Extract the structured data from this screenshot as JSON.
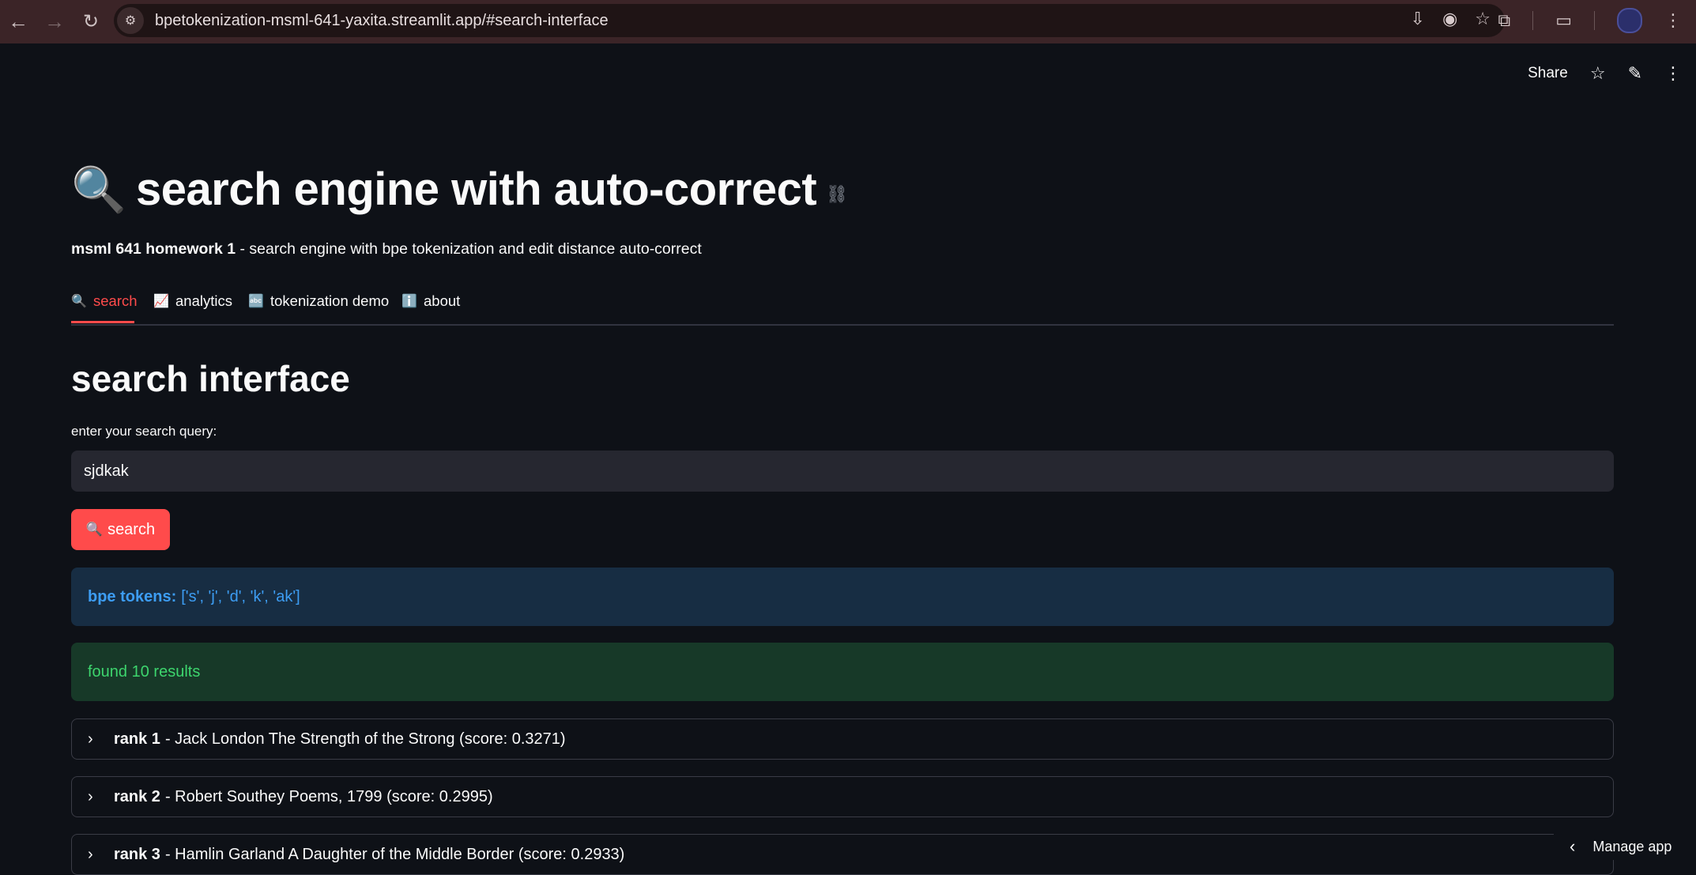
{
  "browser": {
    "url": "bpetokenization-msml-641-yaxita.streamlit.app/#search-interface"
  },
  "header": {
    "share_label": "Share"
  },
  "title": {
    "emoji": "🔍",
    "text": "search engine with auto-correct"
  },
  "subtitle": {
    "bold": "msml 641 homework 1",
    "rest": " - search engine with bpe tokenization and edit distance auto-correct"
  },
  "tabs": [
    {
      "icon": "🔍",
      "label": "search"
    },
    {
      "icon": "📈",
      "label": "analytics"
    },
    {
      "icon": "🔤",
      "label": "tokenization demo"
    },
    {
      "icon": "ℹ️",
      "label": "about"
    }
  ],
  "section_heading": "search interface",
  "search": {
    "label": "enter your search query:",
    "value": "sjdkak",
    "button_icon": "🔍",
    "button_label": "search"
  },
  "info": {
    "label": "bpe tokens:",
    "value": "['s', 'j', 'd', 'k', 'ak']"
  },
  "success": "found 10 results",
  "results": [
    {
      "rank": "rank 1",
      "text": " - Jack London The Strength of the Strong (score: 0.3271)"
    },
    {
      "rank": "rank 2",
      "text": " - Robert Southey Poems, 1799 (score: 0.2995)"
    },
    {
      "rank": "rank 3",
      "text": " - Hamlin Garland A Daughter of the Middle Border (score: 0.2933)"
    }
  ],
  "manage_app": "Manage app",
  "colors": {
    "accent": "#ff4b4b",
    "background": "#0e1117",
    "info_bg": "#172d43",
    "success_bg": "#173928"
  }
}
